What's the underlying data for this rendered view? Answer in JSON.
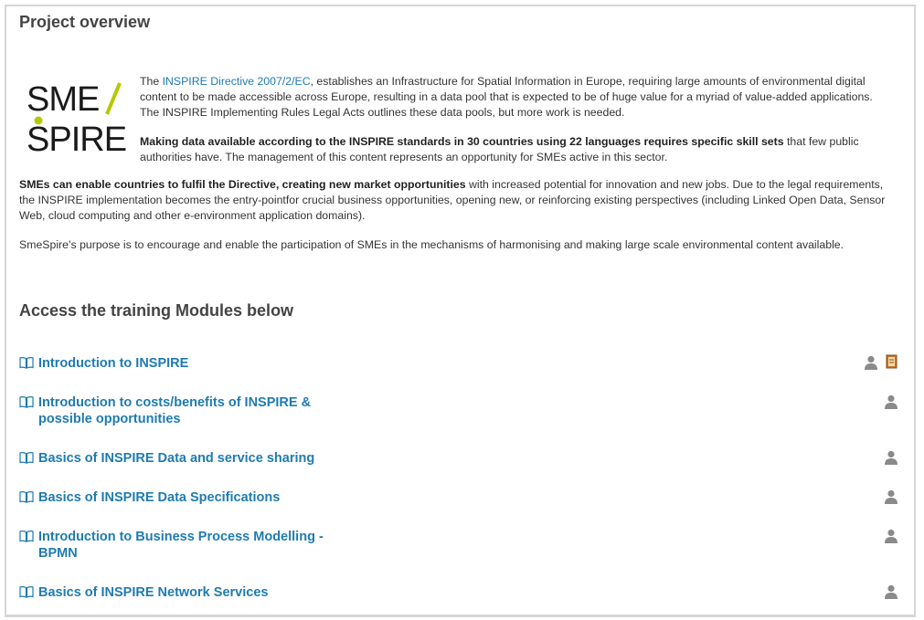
{
  "page": {
    "title": "Project overview"
  },
  "logo": {
    "line1": "SME",
    "line2": "SPIRE",
    "accent_color": "#b5c900"
  },
  "intro": {
    "p1_link": "INSPIRE Directive 2007/2/EC",
    "p1_prefix": "The ",
    "p1_text": ", establishes an Infrastructure for Spatial Information in Europe, requiring large amounts of environmental digital content to be made accessible across Europe,  resulting in a data pool that is expected to be of huge value for a myriad of value-added applications. The INSPIRE Implementing Rules Legal Acts outlines these data pools, but more work is needed.",
    "p2_bold": "Making data available according to the INSPIRE standards in 30 countries using 22 languages requires specific skill sets",
    "p2_text": " that few public authorities have. The management of this content represents an opportunity for SMEs active in this sector.",
    "p3_bold": "SMEs can enable countries to fulfil the Directive, creating new market opportunities",
    "p3_text": " with increased potential for innovation and new jobs. Due to the legal requirements, the INSPIRE implementation becomes the entry-pointfor crucial business opportunities, opening new, or reinforcing existing perspectives (including Linked Open Data, Sensor Web, cloud computing and other e-environment application domains).",
    "p4_text": "SmeSpire’s purpose is to encourage and enable the participation of SMEs in the mechanisms of harmonising and making large scale environmental content available."
  },
  "modules_heading": "Access the training Modules below",
  "modules": [
    {
      "label": "Introduction to INSPIRE"
    },
    {
      "label": "Introduction to costs/benefits of INSPIRE & possible opportunities"
    },
    {
      "label": "Basics of INSPIRE Data and service sharing"
    },
    {
      "label": "Basics of INSPIRE Data Specifications"
    },
    {
      "label": "Introduction to Business Process Modelling - BPMN"
    },
    {
      "label": "Basics of INSPIRE Network Services"
    }
  ],
  "colors": {
    "link": "#1f7bb1",
    "heading": "#444444",
    "icon_grey": "#8a8a8a"
  }
}
